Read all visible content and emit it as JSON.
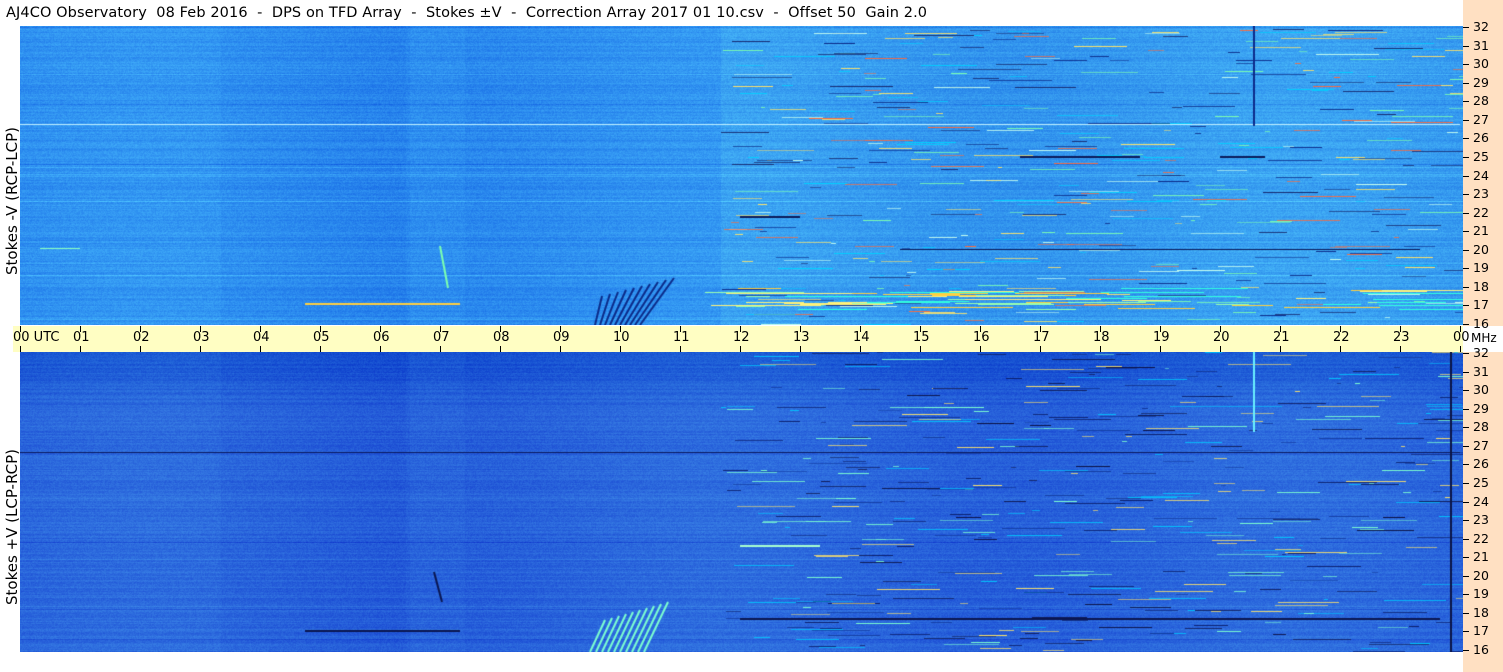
{
  "title": "AJ4CO Observatory  08 Feb 2016  -  DPS on TFD Array  -  Stokes ±V  -  Correction Array 2017 01 10.csv  -  Offset 50  Gain 2.0",
  "top_panel": {
    "ylabel": "Stokes -V (RCP-LCP)"
  },
  "bottom_panel": {
    "ylabel": "Stokes +V (LCP-RCP)"
  },
  "time_axis": {
    "labels": [
      "00 UTC",
      "01",
      "02",
      "03",
      "04",
      "05",
      "06",
      "07",
      "08",
      "09",
      "10",
      "11",
      "12",
      "13",
      "14",
      "15",
      "16",
      "17",
      "18",
      "19",
      "20",
      "21",
      "22",
      "23",
      "00"
    ]
  },
  "freq_axis": {
    "unit": "MHz",
    "labels": [
      "32",
      "31",
      "30",
      "29",
      "28",
      "27",
      "26",
      "25",
      "24",
      "23",
      "22",
      "21",
      "20",
      "19",
      "18",
      "17",
      "16"
    ]
  },
  "colors": {
    "time_bar": "#fffec3",
    "freq_bar": "#ffe0c2",
    "spectrogram_base_top": "#2e8ff0",
    "spectrogram_base_bottom": "#2a66dc"
  }
}
